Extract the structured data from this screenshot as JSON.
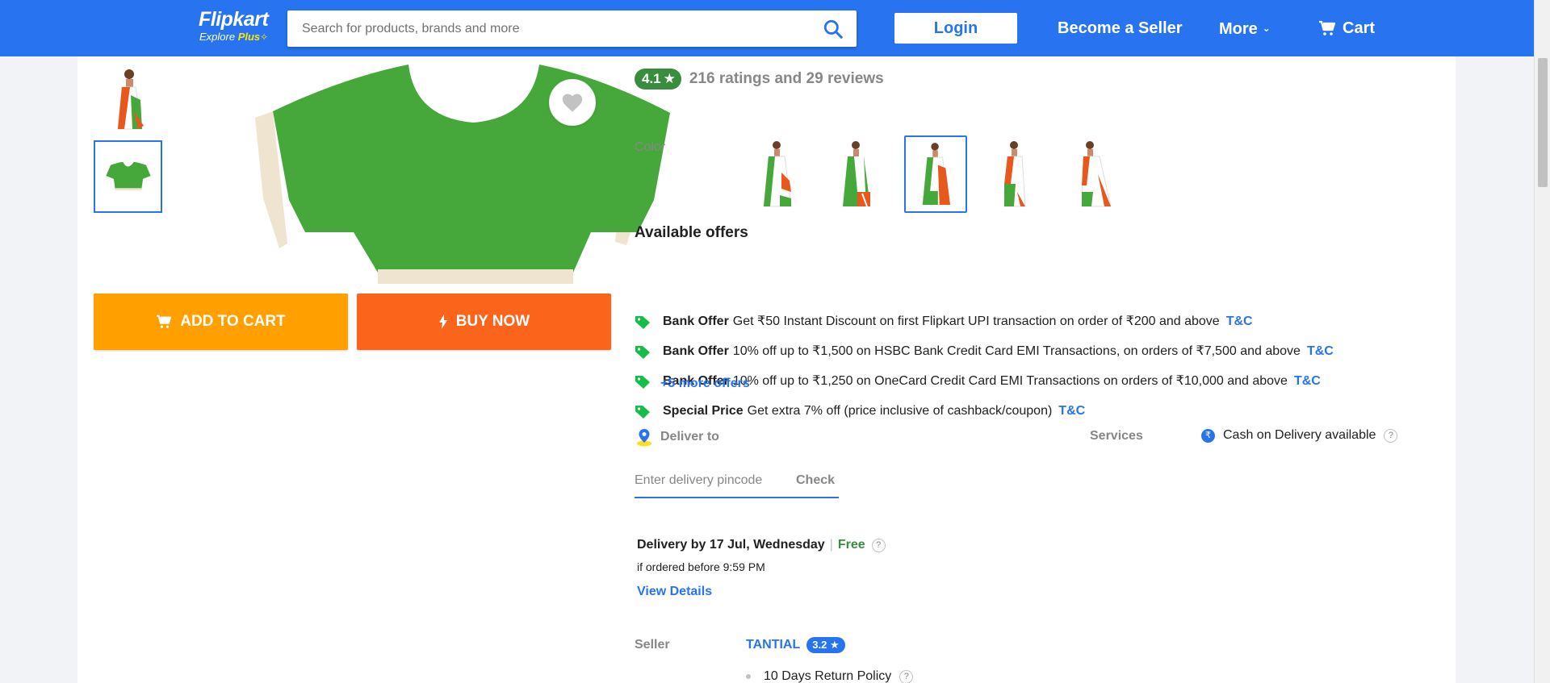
{
  "header": {
    "logo_brand": "Flipkart",
    "logo_sub_prefix": "Explore",
    "logo_sub_plus": "Plus",
    "search_placeholder": "Search for products, brands and more",
    "login_label": "Login",
    "become_seller_label": "Become a Seller",
    "more_label": "More",
    "cart_label": "Cart",
    "brand_color": "#2874f0",
    "accent_color": "#ffe500"
  },
  "gallery": {
    "wishlist_icon": "heart-icon",
    "add_to_cart_label": "ADD TO CART",
    "buy_now_label": "BUY NOW",
    "add_to_cart_color": "#ff9f00",
    "buy_now_color": "#fb641b",
    "product_color": "#46a83a"
  },
  "product": {
    "rating": "4.1",
    "rating_text": "216 ratings and 29 reviews",
    "color_label": "Color",
    "selected_color_index": 2
  },
  "offers": {
    "title": "Available offers",
    "items": [
      {
        "kind": "Bank Offer",
        "text": "Get ₹50 Instant Discount on first Flipkart UPI transaction on order of ₹200 and above",
        "tc": "T&C"
      },
      {
        "kind": "Bank Offer",
        "text": "10% off up to ₹1,500 on HSBC Bank Credit Card EMI Transactions, on orders of ₹7,500 and above",
        "tc": "T&C"
      },
      {
        "kind": "Bank Offer",
        "text": "10% off up to ₹1,250 on OneCard Credit Card EMI Transactions on orders of ₹10,000 and above",
        "tc": "T&C"
      },
      {
        "kind": "Special Price",
        "text": "Get extra 7% off (price inclusive of cashback/coupon)",
        "tc": "T&C"
      }
    ],
    "more_label": "+5 more offers"
  },
  "delivery": {
    "deliver_to_label": "Deliver to",
    "pincode_placeholder": "Enter delivery pincode",
    "check_label": "Check",
    "services_label": "Services",
    "cod_label": "Cash on Delivery available",
    "delivery_by": "Delivery by 17 Jul, Wednesday",
    "free_label": "Free",
    "ordered_before": "if ordered before 9:59 PM",
    "view_details_label": "View Details"
  },
  "seller": {
    "label": "Seller",
    "name": "TANTIAL",
    "rating": "3.2",
    "policy": "10 Days Return Policy"
  }
}
